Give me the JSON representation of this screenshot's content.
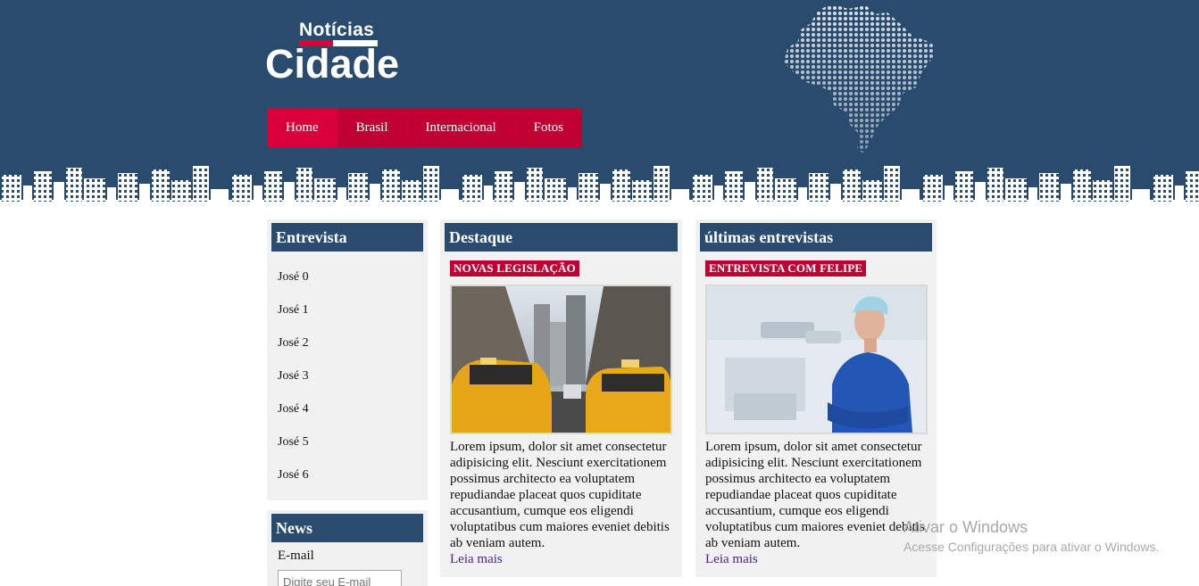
{
  "logo": {
    "top": "Notícias",
    "main": "Cidade"
  },
  "nav": [
    "Home",
    "Brasil",
    "Internacional",
    "Fotos"
  ],
  "sidebar_entrevista": {
    "title": "Entrevista",
    "items": [
      "José 0",
      "José 1",
      "José 2",
      "José 3",
      "José 4",
      "José 5",
      "José 6"
    ]
  },
  "sidebar_news": {
    "title": "News",
    "email_label": "E-mail",
    "email_placeholder": "Digite seu E-mail"
  },
  "cards": [
    {
      "title": "Destaque",
      "tag": "NOVAS LEGISLAÇÃO",
      "image": "city-taxis-photo",
      "text": "Lorem ipsum, dolor sit amet consectetur adipisicing elit. Nesciunt exercitationem possimus architecto ea voluptatem repudiandae placeat quos cupiditate accusantium, cumque eos eligendi voluptatibus cum maiores eveniet debitis ab veniam autem.",
      "link": "Leia mais"
    },
    {
      "title": "últimas entrevistas",
      "tag": "ENTREVISTA COM FELIPE",
      "image": "doctor-photo",
      "text": "Lorem ipsum, dolor sit amet consectetur adipisicing elit. Nesciunt exercitationem possimus architecto ea voluptatem repudiandae placeat quos cupiditate accusantium, cumque eos eligendi voluptatibus cum maiores eveniet debitis ab veniam autem.",
      "link": "Leia mais"
    }
  ],
  "watermark": {
    "title": "Ativar o Windows",
    "subtitle": "Acesse Configurações para ativar o Windows."
  },
  "colors": {
    "header_bg": "#294b6e",
    "accent_red": "#d7003a",
    "nav_dark_red": "#be0033",
    "box_bg": "#f1f1f1"
  }
}
